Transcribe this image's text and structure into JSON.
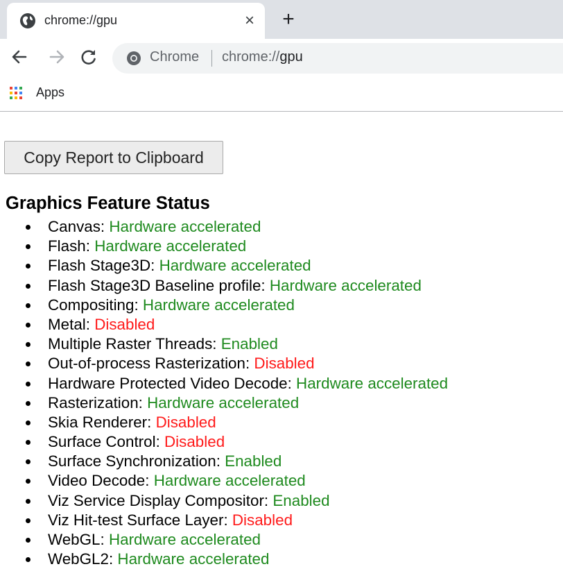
{
  "tab": {
    "title": "chrome://gpu",
    "close_glyph": "×",
    "new_tab_glyph": "+",
    "favicon": "globe-icon"
  },
  "toolbar": {
    "back_icon": "arrow-left-icon",
    "forward_icon": "arrow-right-icon",
    "reload_icon": "reload-icon",
    "omnibox": {
      "chip_label": "Chrome",
      "url_prefix": "chrome://",
      "url_host": "gpu"
    }
  },
  "bookmarks": {
    "apps_label": "Apps"
  },
  "content": {
    "copy_button_label": "Copy Report to Clipboard",
    "section_title": "Graphics Feature Status",
    "features": [
      {
        "name": "Canvas: ",
        "status": "Hardware accelerated",
        "state": "green"
      },
      {
        "name": "Flash: ",
        "status": "Hardware accelerated",
        "state": "green"
      },
      {
        "name": "Flash Stage3D: ",
        "status": "Hardware accelerated",
        "state": "green"
      },
      {
        "name": "Flash Stage3D Baseline profile: ",
        "status": "Hardware accelerated",
        "state": "green"
      },
      {
        "name": "Compositing: ",
        "status": "Hardware accelerated",
        "state": "green"
      },
      {
        "name": "Metal: ",
        "status": "Disabled",
        "state": "red"
      },
      {
        "name": "Multiple Raster Threads: ",
        "status": "Enabled",
        "state": "green"
      },
      {
        "name": "Out-of-process Rasterization: ",
        "status": "Disabled",
        "state": "red"
      },
      {
        "name": "Hardware Protected Video Decode: ",
        "status": "Hardware accelerated",
        "state": "green"
      },
      {
        "name": "Rasterization: ",
        "status": "Hardware accelerated",
        "state": "green"
      },
      {
        "name": "Skia Renderer: ",
        "status": "Disabled",
        "state": "red"
      },
      {
        "name": "Surface Control: ",
        "status": "Disabled",
        "state": "red"
      },
      {
        "name": "Surface Synchronization: ",
        "status": "Enabled",
        "state": "green"
      },
      {
        "name": "Video Decode: ",
        "status": "Hardware accelerated",
        "state": "green"
      },
      {
        "name": "Viz Service Display Compositor: ",
        "status": "Enabled",
        "state": "green"
      },
      {
        "name": "Viz Hit-test Surface Layer: ",
        "status": "Disabled",
        "state": "red"
      },
      {
        "name": "WebGL: ",
        "status": "Hardware accelerated",
        "state": "green"
      },
      {
        "name": "WebGL2: ",
        "status": "Hardware accelerated",
        "state": "green"
      }
    ]
  },
  "colors": {
    "enabled": "#1e8a1e",
    "disabled": "#ff1a1a",
    "tabstrip": "#dee1e6",
    "omnibox": "#f1f3f4"
  }
}
